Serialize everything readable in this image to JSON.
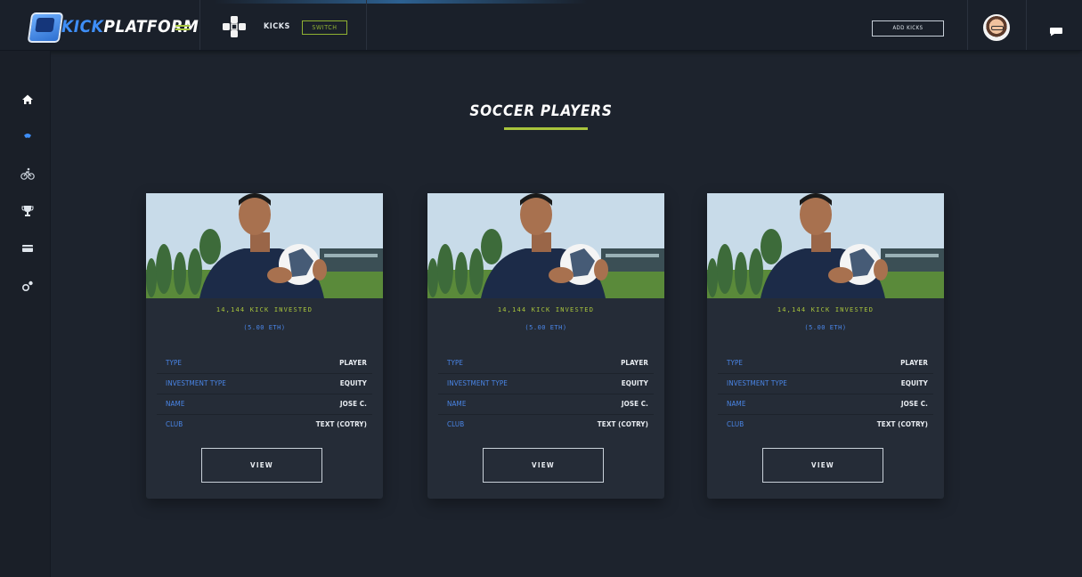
{
  "header": {
    "logo_text_kick": "KICK",
    "logo_text_platform": "PLATFORM",
    "kicks_label": "KICKS",
    "switch_label": "SWITCH",
    "add_kicks_label": "ADD KICKS"
  },
  "sidebar": {
    "items": [
      {
        "icon": "home-icon"
      },
      {
        "icon": "soccer-icon"
      },
      {
        "icon": "cycling-icon"
      },
      {
        "icon": "trophy-icon"
      },
      {
        "icon": "card-icon"
      },
      {
        "icon": "settings-icon"
      }
    ]
  },
  "page": {
    "title": "SOCCER PLAYERS"
  },
  "cards": [
    {
      "invested": "14,144 KICK INVESTED",
      "eth": "(5.00 ETH)",
      "rows": [
        {
          "label": "TYPE",
          "value": "PLAYER"
        },
        {
          "label": "INVESTMENT TYPE",
          "value": "EQUITY"
        },
        {
          "label": "NAME",
          "value": "JOSE C."
        },
        {
          "label": "CLUB",
          "value": "TEXT (COTRY)"
        }
      ],
      "view_label": "VIEW"
    },
    {
      "invested": "14,144 KICK INVESTED",
      "eth": "(5.00 ETH)",
      "rows": [
        {
          "label": "TYPE",
          "value": "PLAYER"
        },
        {
          "label": "INVESTMENT TYPE",
          "value": "EQUITY"
        },
        {
          "label": "NAME",
          "value": "JOSE C."
        },
        {
          "label": "CLUB",
          "value": "TEXT (COTRY)"
        }
      ],
      "view_label": "VIEW"
    },
    {
      "invested": "14,144 KICK INVESTED",
      "eth": "(5.00 ETH)",
      "rows": [
        {
          "label": "TYPE",
          "value": "PLAYER"
        },
        {
          "label": "INVESTMENT TYPE",
          "value": "EQUITY"
        },
        {
          "label": "NAME",
          "value": "JOSE C."
        },
        {
          "label": "CLUB",
          "value": "TEXT (COTRY)"
        }
      ],
      "view_label": "VIEW"
    }
  ],
  "colors": {
    "background": "#1d232d",
    "accent_green": "#a8c43c",
    "accent_blue": "#4a86e8",
    "card": "#252c37"
  }
}
